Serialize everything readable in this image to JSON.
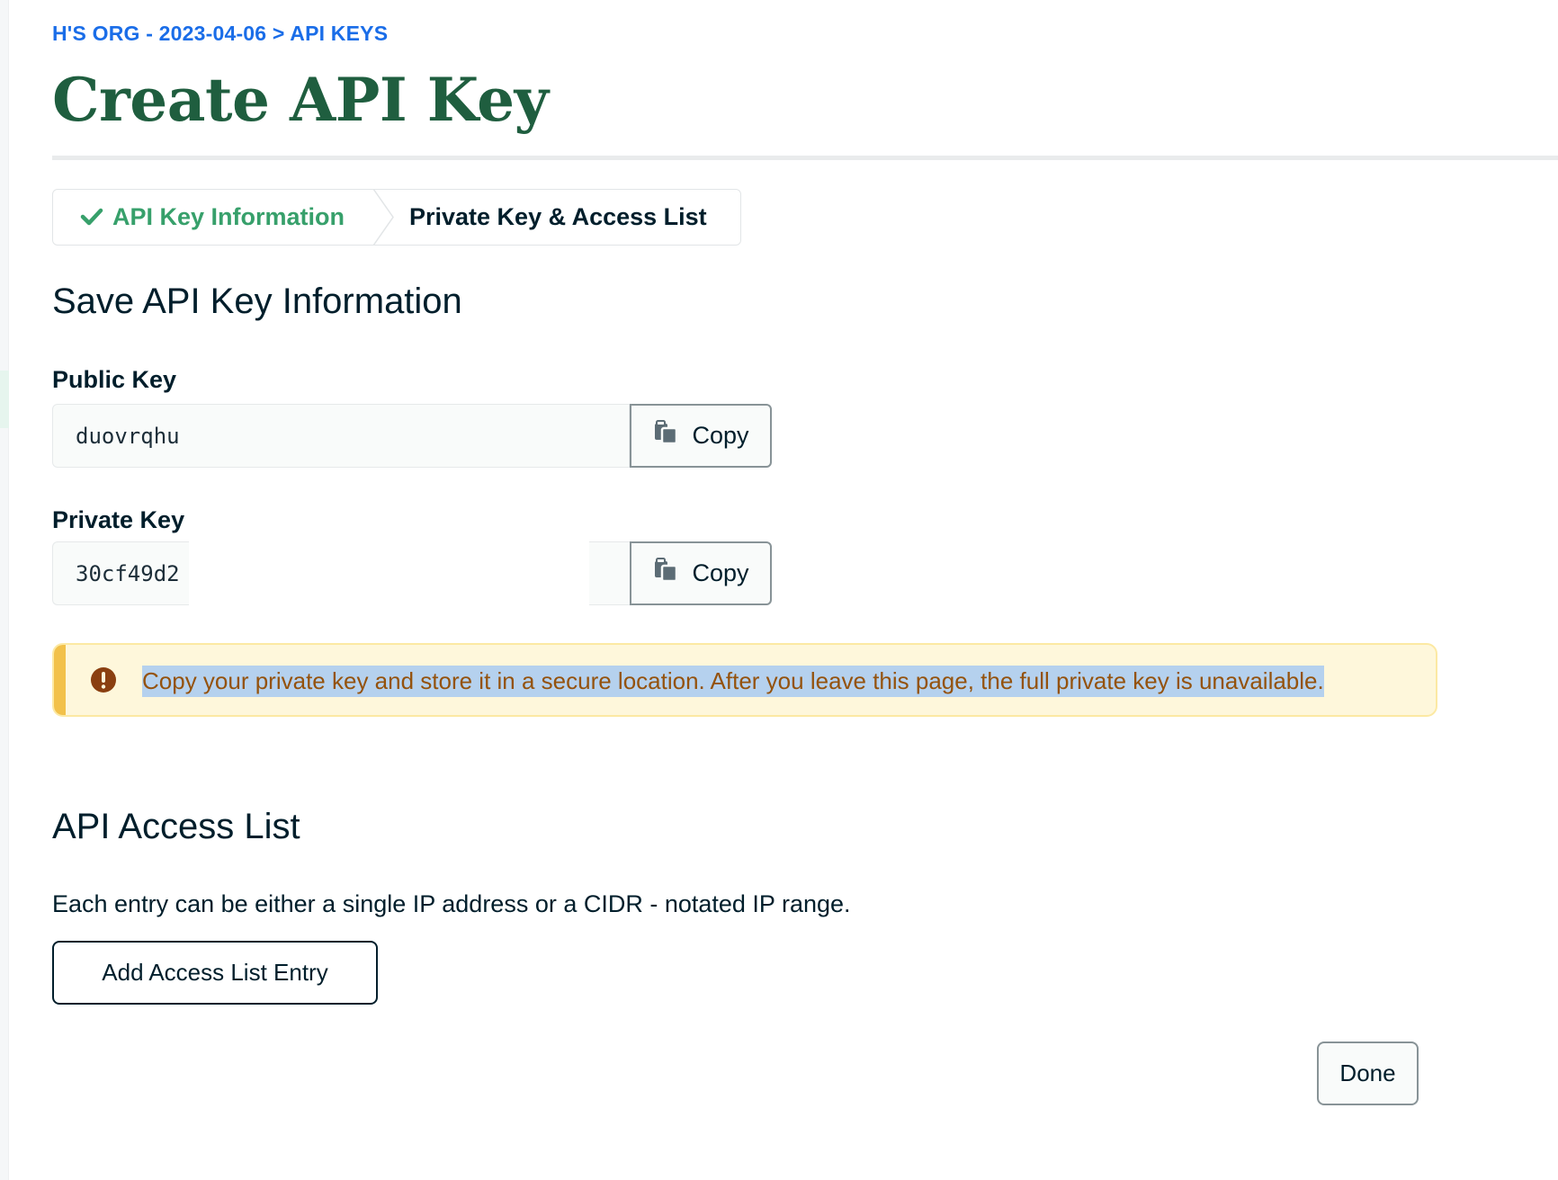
{
  "breadcrumb": {
    "org": "H'S ORG - 2023-04-06",
    "separator": ">",
    "section": "API KEYS"
  },
  "page": {
    "title": "Create API Key"
  },
  "stepper": {
    "steps": [
      {
        "label": "API Key Information",
        "state": "completed",
        "icon": "checkmark-icon"
      },
      {
        "label": "Private Key & Access List",
        "state": "current"
      }
    ]
  },
  "save_section": {
    "heading": "Save API Key Information",
    "public_key": {
      "label": "Public Key",
      "value": "duovrqhu",
      "copy_label": "Copy",
      "copy_icon": "copy-icon"
    },
    "private_key": {
      "label": "Private Key",
      "value": "30cf49d2",
      "copy_label": "Copy",
      "copy_icon": "copy-icon"
    },
    "warning": {
      "icon": "exclamation-circle-icon",
      "message": "Copy your private key and store it in a secure location. After you leave this page, the full private key is unavailable."
    }
  },
  "access_list": {
    "heading": "API Access List",
    "description": "Each entry can be either a single IP address or a CIDR - notated IP range.",
    "add_button_label": "Add Access List Entry"
  },
  "footer": {
    "done_label": "Done"
  },
  "colors": {
    "breadcrumb": "#1a6de8",
    "title": "#1f5e3f",
    "step_complete": "#37a06b",
    "warning_bg": "#fef7db",
    "warning_accent": "#f2c14a",
    "warning_text": "#94520d",
    "selection_highlight": "#b5d1ee"
  }
}
